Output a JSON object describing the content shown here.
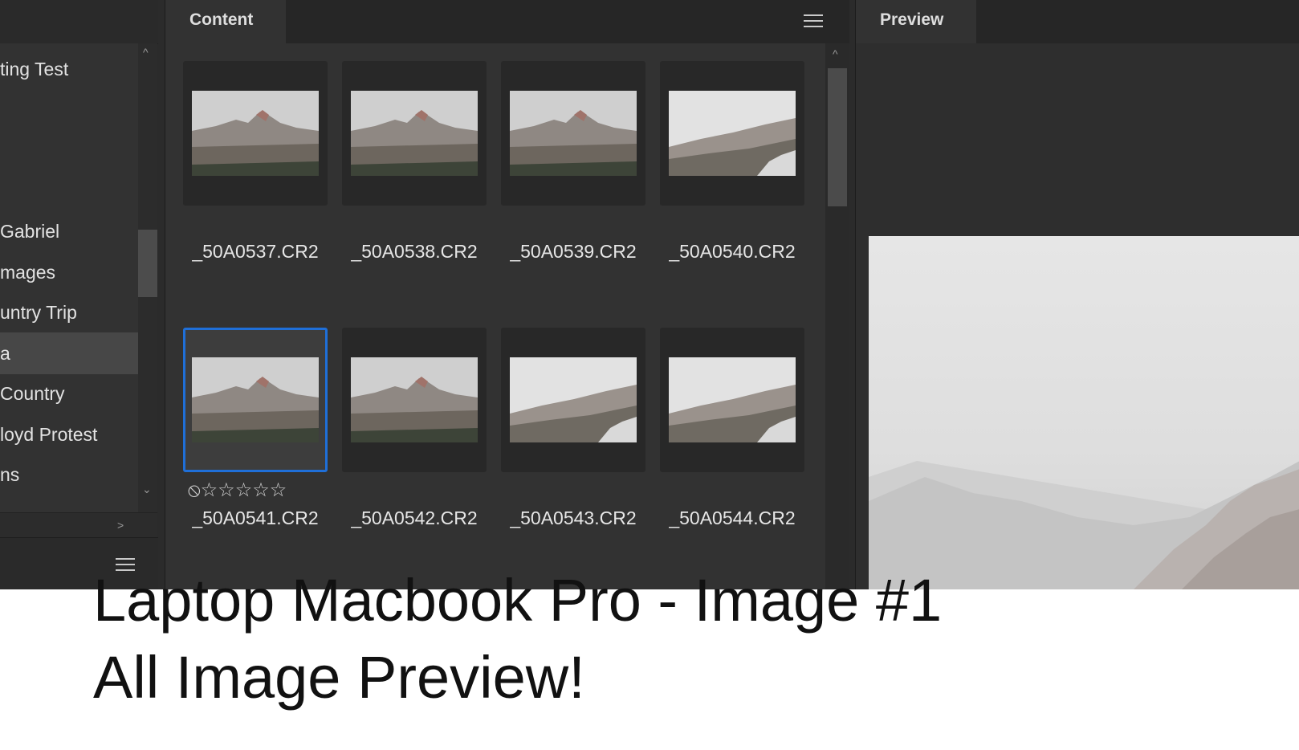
{
  "folders": {
    "items": [
      {
        "label": "ting Test",
        "selected": false
      },
      {
        "label": "Gabriel",
        "selected": false
      },
      {
        "label": "mages",
        "selected": false
      },
      {
        "label": "untry Trip",
        "selected": false
      },
      {
        "label": "a",
        "selected": true
      },
      {
        "label": "Country",
        "selected": false
      },
      {
        "label": "loyd Protest",
        "selected": false
      },
      {
        "label": "ns",
        "selected": false
      }
    ],
    "arrow_up": "^",
    "arrow_down": "⌄",
    "arrow_right": ">"
  },
  "content": {
    "tab_label": "Content",
    "files": [
      {
        "name": "_50A0537.CR2",
        "selected": false,
        "scene": "peak"
      },
      {
        "name": "_50A0538.CR2",
        "selected": false,
        "scene": "peak"
      },
      {
        "name": "_50A0539.CR2",
        "selected": false,
        "scene": "peak"
      },
      {
        "name": "_50A0540.CR2",
        "selected": false,
        "scene": "slope"
      },
      {
        "name": "_50A0541.CR2",
        "selected": true,
        "scene": "peak",
        "rating_text": "⃠☆☆☆☆☆"
      },
      {
        "name": "_50A0542.CR2",
        "selected": false,
        "scene": "peak"
      },
      {
        "name": "_50A0543.CR2",
        "selected": false,
        "scene": "slope"
      },
      {
        "name": "_50A0544.CR2",
        "selected": false,
        "scene": "slope"
      }
    ],
    "reject_icon": "⦸",
    "stars": "☆☆☆☆☆",
    "scroll_up": "^"
  },
  "preview": {
    "tab_label": "Preview"
  },
  "caption": {
    "line1": "Laptop Macbook Pro - Image #1",
    "line2": "All Image Preview!"
  },
  "colors": {
    "selection": "#1f6fd8",
    "panel": "#323232"
  }
}
